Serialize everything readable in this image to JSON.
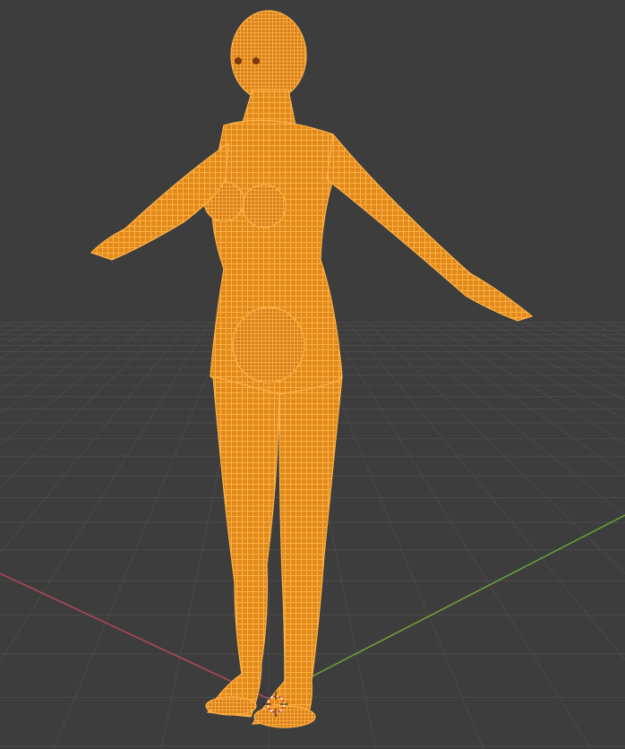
{
  "viewport": {
    "background_color": "#3d3d3d",
    "grid_color": "#4a4a4a",
    "x_axis_color": "#b34a55",
    "y_axis_color": "#6fa13a",
    "mesh_color": "#ff9f2a",
    "mesh_dark_color": "#c06a10",
    "selected_object": "human-body-mesh",
    "display_mode": "wireframe"
  },
  "scene": {
    "object": {
      "icon": "mannequin-icon"
    },
    "cursor": {
      "icon": "3d-cursor-icon"
    }
  }
}
